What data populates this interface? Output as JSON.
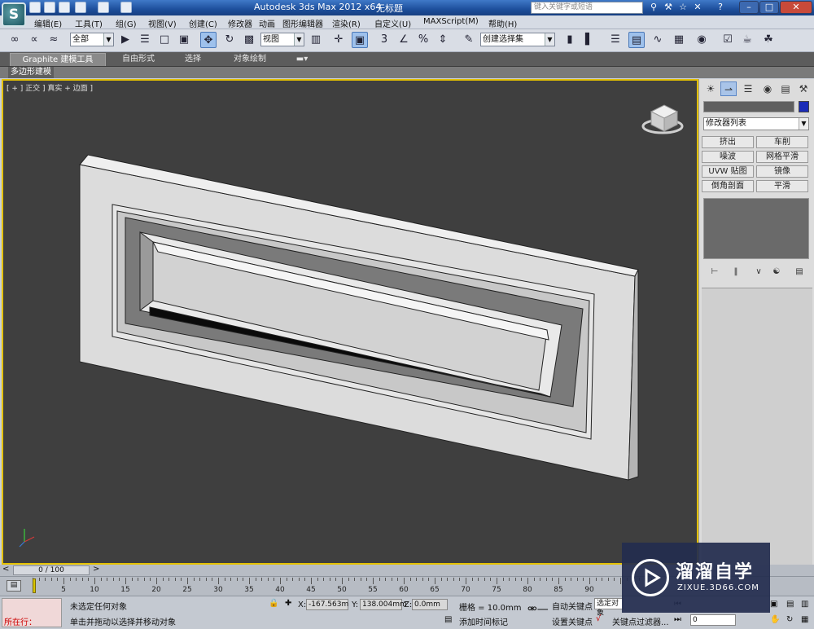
{
  "titlebar": {
    "app_title": "Autodesk 3ds Max  2012 x64",
    "doc_title": "无标题",
    "search_placeholder": "键入关键字或短语"
  },
  "menubar": {
    "items": [
      "编辑(E)",
      "工具(T)",
      "组(G)",
      "视图(V)",
      "创建(C)",
      "修改器",
      "动画",
      "图形编辑器",
      "渲染(R)",
      "自定义(U)",
      "MAXScript(M)",
      "帮助(H)"
    ]
  },
  "toolbar": {
    "selection_filter": "全部",
    "reference_coord": "视图",
    "named_selection": "创建选择集"
  },
  "ribbon": {
    "tabs": [
      "Graphite 建模工具",
      "自由形式",
      "选择",
      "对象绘制"
    ],
    "sub_label": "多边形建模"
  },
  "viewport": {
    "label": "[ + ] 正交 ] 真实 + 边面 ]"
  },
  "command_panel": {
    "modifier_list": "修改器列表",
    "modifier_buttons": [
      "挤出",
      "车削",
      "噪波",
      "网格平滑",
      "UVW 贴图",
      "镜像",
      "倒角剖面",
      "平滑"
    ]
  },
  "timeline": {
    "frame_readout": "0 / 100",
    "ticks": [
      5,
      10,
      15,
      20,
      25,
      30,
      35,
      40,
      45,
      50,
      55,
      60,
      65,
      70,
      75,
      80,
      85,
      90
    ]
  },
  "statusbar": {
    "script_label": "所在行：",
    "selection_status": "未选定任何对象",
    "prompt": "单击并拖动以选择并移动对象",
    "x_label": "X:",
    "x_value": "-167.563m",
    "y_label": "Y:",
    "y_value": "138.004mm",
    "z_label": "Z:",
    "z_value": "0.0mm",
    "grid": "栅格 = 10.0mm",
    "add_time_tag": "添加时间标记",
    "auto_key": "自动关键点",
    "selected": "选定对象",
    "set_key": "设置关键点",
    "key_filters": "关键点过滤器...",
    "frame_field": "0"
  },
  "watermark": {
    "title": "溜溜自学",
    "subtitle": "ZIXUE.3D66.COM"
  },
  "colors": {
    "viewport_bg": "#3f3f3f",
    "viewport_border": "#e4c100",
    "object_color": "#1a2bb7"
  }
}
